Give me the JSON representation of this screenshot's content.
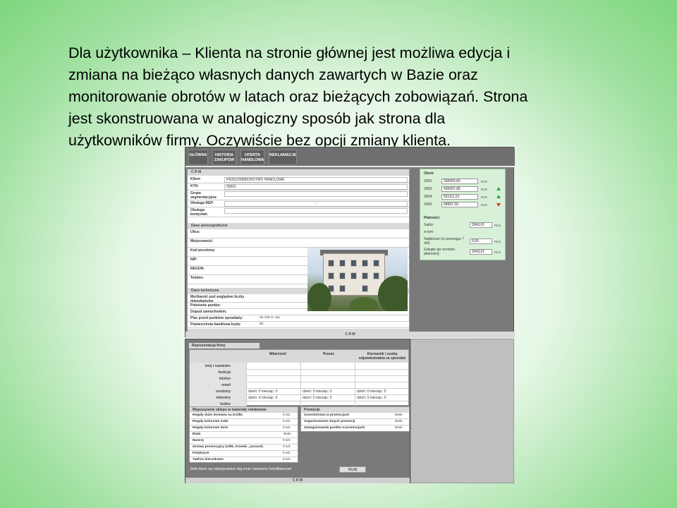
{
  "slide": {
    "lines": [
      "Dla użytkownika – Klienta na stronie głównej jest możliwa edycja i",
      "zmiana na bieżąco własnych danych zawartych w Bazie oraz",
      "monitorowanie obrotów w latach oraz bieżących zobowiązań. Strona",
      "jest skonstruowana w analogiczny sposób jak strona dla",
      "użytkowników firmy. Oczywiście bez opcji zmiany klienta."
    ]
  },
  "nav": {
    "items": [
      "GŁÓWNA",
      "HISTORIA ZAKUPÓW",
      "OFERTA HANDLOWA",
      "REKLAMACJE"
    ]
  },
  "crm": {
    "title": "C R M",
    "rows": [
      {
        "label": "Klient",
        "value": "PRZEDSIĘBIORSTWO HANDLOWE"
      },
      {
        "label": "KTH:",
        "value": "00001"
      },
      {
        "label": "Grupa segmentacyjna:",
        "value": ""
      },
      {
        "label": "Obsługa REP:",
        "value": "-"
      },
      {
        "label": "Obsługa kontystak:",
        "value": ""
      }
    ]
  },
  "address": {
    "title": "Dane adresograficzne",
    "rows": [
      "Ulica:",
      "Miejscowość:",
      "Kod pocztowy:",
      "NIP:",
      "REGON:",
      "Telefon:"
    ]
  },
  "technical": {
    "title": "Dane techniczne",
    "rows": [
      {
        "label": "Możliwość pod względem liczby mieszkańców",
        "value": ""
      },
      {
        "label": "Położenie punktu:",
        "value": ""
      },
      {
        "label": "Dojazd samochodem:",
        "value": ""
      },
      {
        "label": "Plac przed punktem sprzedaży:",
        "value": "do 100 m. kw."
      },
      {
        "label": "Powierzchnia handlowa kryta:",
        "value": "50"
      }
    ]
  },
  "crm_footer": "C R M",
  "turnover": {
    "title": "Obrót",
    "rows": [
      {
        "year": "2002:",
        "value": "256050,60",
        "unit": "PLN",
        "trend": "none"
      },
      {
        "year": "2003:",
        "value": "420097,96",
        "unit": "PLN",
        "trend": "up"
      },
      {
        "year": "2004:",
        "value": "651111,51",
        "unit": "PLN",
        "trend": "up"
      },
      {
        "year": "2005:",
        "value": "99997,39",
        "unit": "PLN",
        "trend": "down"
      }
    ]
  },
  "payments": {
    "title": "Płatności",
    "rows": [
      {
        "label": "Saldo:",
        "value": "3043,01",
        "unit": "PLN"
      },
      {
        "label": "w tym:",
        "value": "",
        "unit": ""
      },
      {
        "label": "Najbliższe (w przeciągu 7 dni):",
        "value": "0,00",
        "unit": "PLN"
      },
      {
        "label": "Zaległe (po terminie płatności):",
        "value": "3043,01",
        "unit": "PLN"
      }
    ]
  },
  "representation": {
    "title": "Reprezentacja firmy",
    "headers": [
      "Właściciel",
      "Prezes",
      "Kierownik / osoba odpowiedzialna za sprzedaż"
    ],
    "rows": [
      {
        "label": "imię i nazwisko",
        "cells": [
          "",
          "",
          ""
        ]
      },
      {
        "label": "funkcja",
        "cells": [
          "",
          "",
          ""
        ]
      },
      {
        "label": "telefon",
        "cells": [
          "",
          "",
          ""
        ]
      },
      {
        "label": "email",
        "cells": [
          "",
          "",
          ""
        ]
      },
      {
        "label": "urodziny",
        "cells": [
          "dzień: 0 miesiąc: 0",
          "dzień: 0 miesiąc: 0",
          "dzień: 0 miesiąc: 0"
        ]
      },
      {
        "label": "imieniny",
        "cells": [
          "dzień: 0 miesiąc: 0",
          "dzień: 0 miesiąc: 0",
          "dzień: 0 miesiąc: 0"
        ]
      },
      {
        "label": "hobby",
        "cells": [
          "",
          "",
          ""
        ]
      }
    ]
  },
  "equipment": {
    "title": "Wyposażenie sklepu w materiały reklamowe",
    "rows": [
      {
        "label": "Regały duże dostawa na źródła",
        "value": "0 szt."
      },
      {
        "label": "Regały kolorowe małe",
        "value": "0 szt."
      },
      {
        "label": "Regały kolorowe duże",
        "value": "0 szt."
      },
      {
        "label": "Biała",
        "value": "-brak-"
      },
      {
        "label": "Banery",
        "value": "0 szt."
      },
      {
        "label": "Zestaw promocyjny (zółki, krzesła , parasol)",
        "value": "0 szt."
      },
      {
        "label": "Potykacze",
        "value": "0 szt."
      },
      {
        "label": "Tablice kierunkowe",
        "value": "0 szt."
      }
    ]
  },
  "promotions": {
    "title": "Promocje",
    "rows": [
      {
        "label": "Uczestnictwo w promocjach",
        "value": "-brak-"
      },
      {
        "label": "Organizowanie innych promocji",
        "value": "-brak-"
      },
      {
        "label": "Zaangażowanie punktu w promocjach",
        "value": "-brak-"
      }
    ]
  },
  "footer": {
    "note": "Jeśli dane są niepoprawne daj znać naszemu handlowcowi",
    "button": "Wyślij",
    "crm": "C R M"
  }
}
